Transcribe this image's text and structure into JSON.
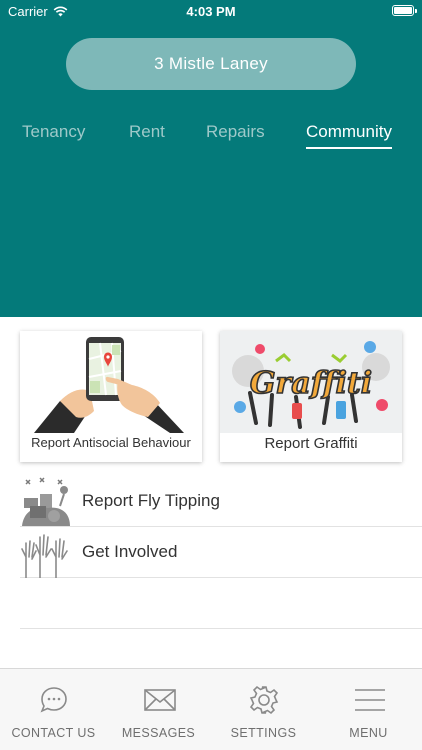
{
  "status_bar": {
    "carrier": "Carrier",
    "time": "4:03 PM"
  },
  "address": "3 Mistle Laney",
  "tabs": [
    {
      "label": "Tenancy",
      "active": false
    },
    {
      "label": "Rent",
      "active": false
    },
    {
      "label": "Repairs",
      "active": false
    },
    {
      "label": "Community",
      "active": true
    }
  ],
  "cards": [
    {
      "label": "Report Antisocial Behaviour",
      "icon": "phone-map-icon"
    },
    {
      "label": "Report Graffiti",
      "icon": "graffiti-image"
    }
  ],
  "list_items": [
    {
      "label": "Report Fly Tipping",
      "icon": "fly-tipping-icon"
    },
    {
      "label": "Get Involved",
      "icon": "raised-hands-icon"
    }
  ],
  "bottom_nav": [
    {
      "label": "CONTACT US",
      "icon": "chat-bubble-icon"
    },
    {
      "label": "MESSAGES",
      "icon": "envelope-icon"
    },
    {
      "label": "SETTINGS",
      "icon": "gear-icon"
    },
    {
      "label": "MENU",
      "icon": "hamburger-icon"
    }
  ],
  "colors": {
    "header": "#047a7a",
    "pill": "#7eb8b8",
    "tab_inactive": "#9ec9c9",
    "nav_icon": "#8a8a8a"
  }
}
